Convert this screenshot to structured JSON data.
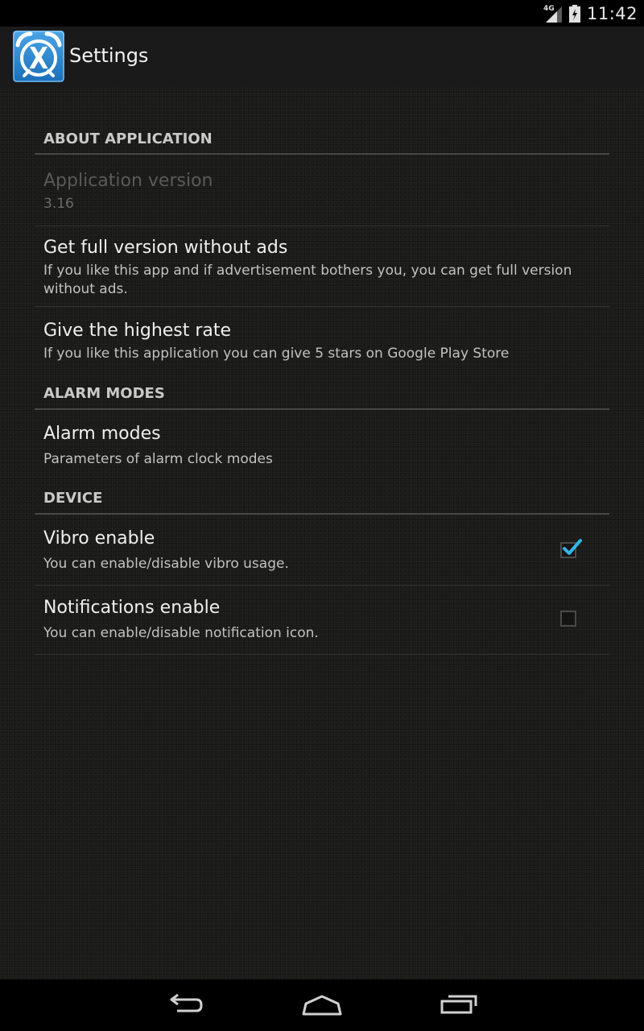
{
  "status_bar": {
    "network": "4G",
    "time": "11:42"
  },
  "action_bar": {
    "title": "Settings",
    "app_icon": "alarm-clock-x-icon"
  },
  "sections": {
    "about": {
      "title": "ABOUT APPLICATION",
      "version_title": "Application version",
      "version_value": "3.16",
      "full_version_title": "Get full version without ads",
      "full_version_summary": "If you like this app and if advertisement bothers you, you can get full version without ads.",
      "rate_title": "Give the highest rate",
      "rate_summary": "If you like this application you can give 5 stars on Google Play Store"
    },
    "alarm_modes": {
      "title": "ALARM MODES",
      "modes_title": "Alarm modes",
      "modes_summary": "Parameters of alarm clock modes"
    },
    "device": {
      "title": "DEVICE",
      "vibro_title": "Vibro enable",
      "vibro_summary": "You can enable/disable vibro usage.",
      "vibro_checked": true,
      "notif_title": "Notifications enable",
      "notif_summary": "You can enable/disable notification icon.",
      "notif_checked": false
    }
  },
  "nav_bar": {
    "back": "back-icon",
    "home": "home-icon",
    "recents": "recents-icon"
  },
  "colors": {
    "check_accent": "#33b5e5",
    "background": "#1a1a19"
  }
}
